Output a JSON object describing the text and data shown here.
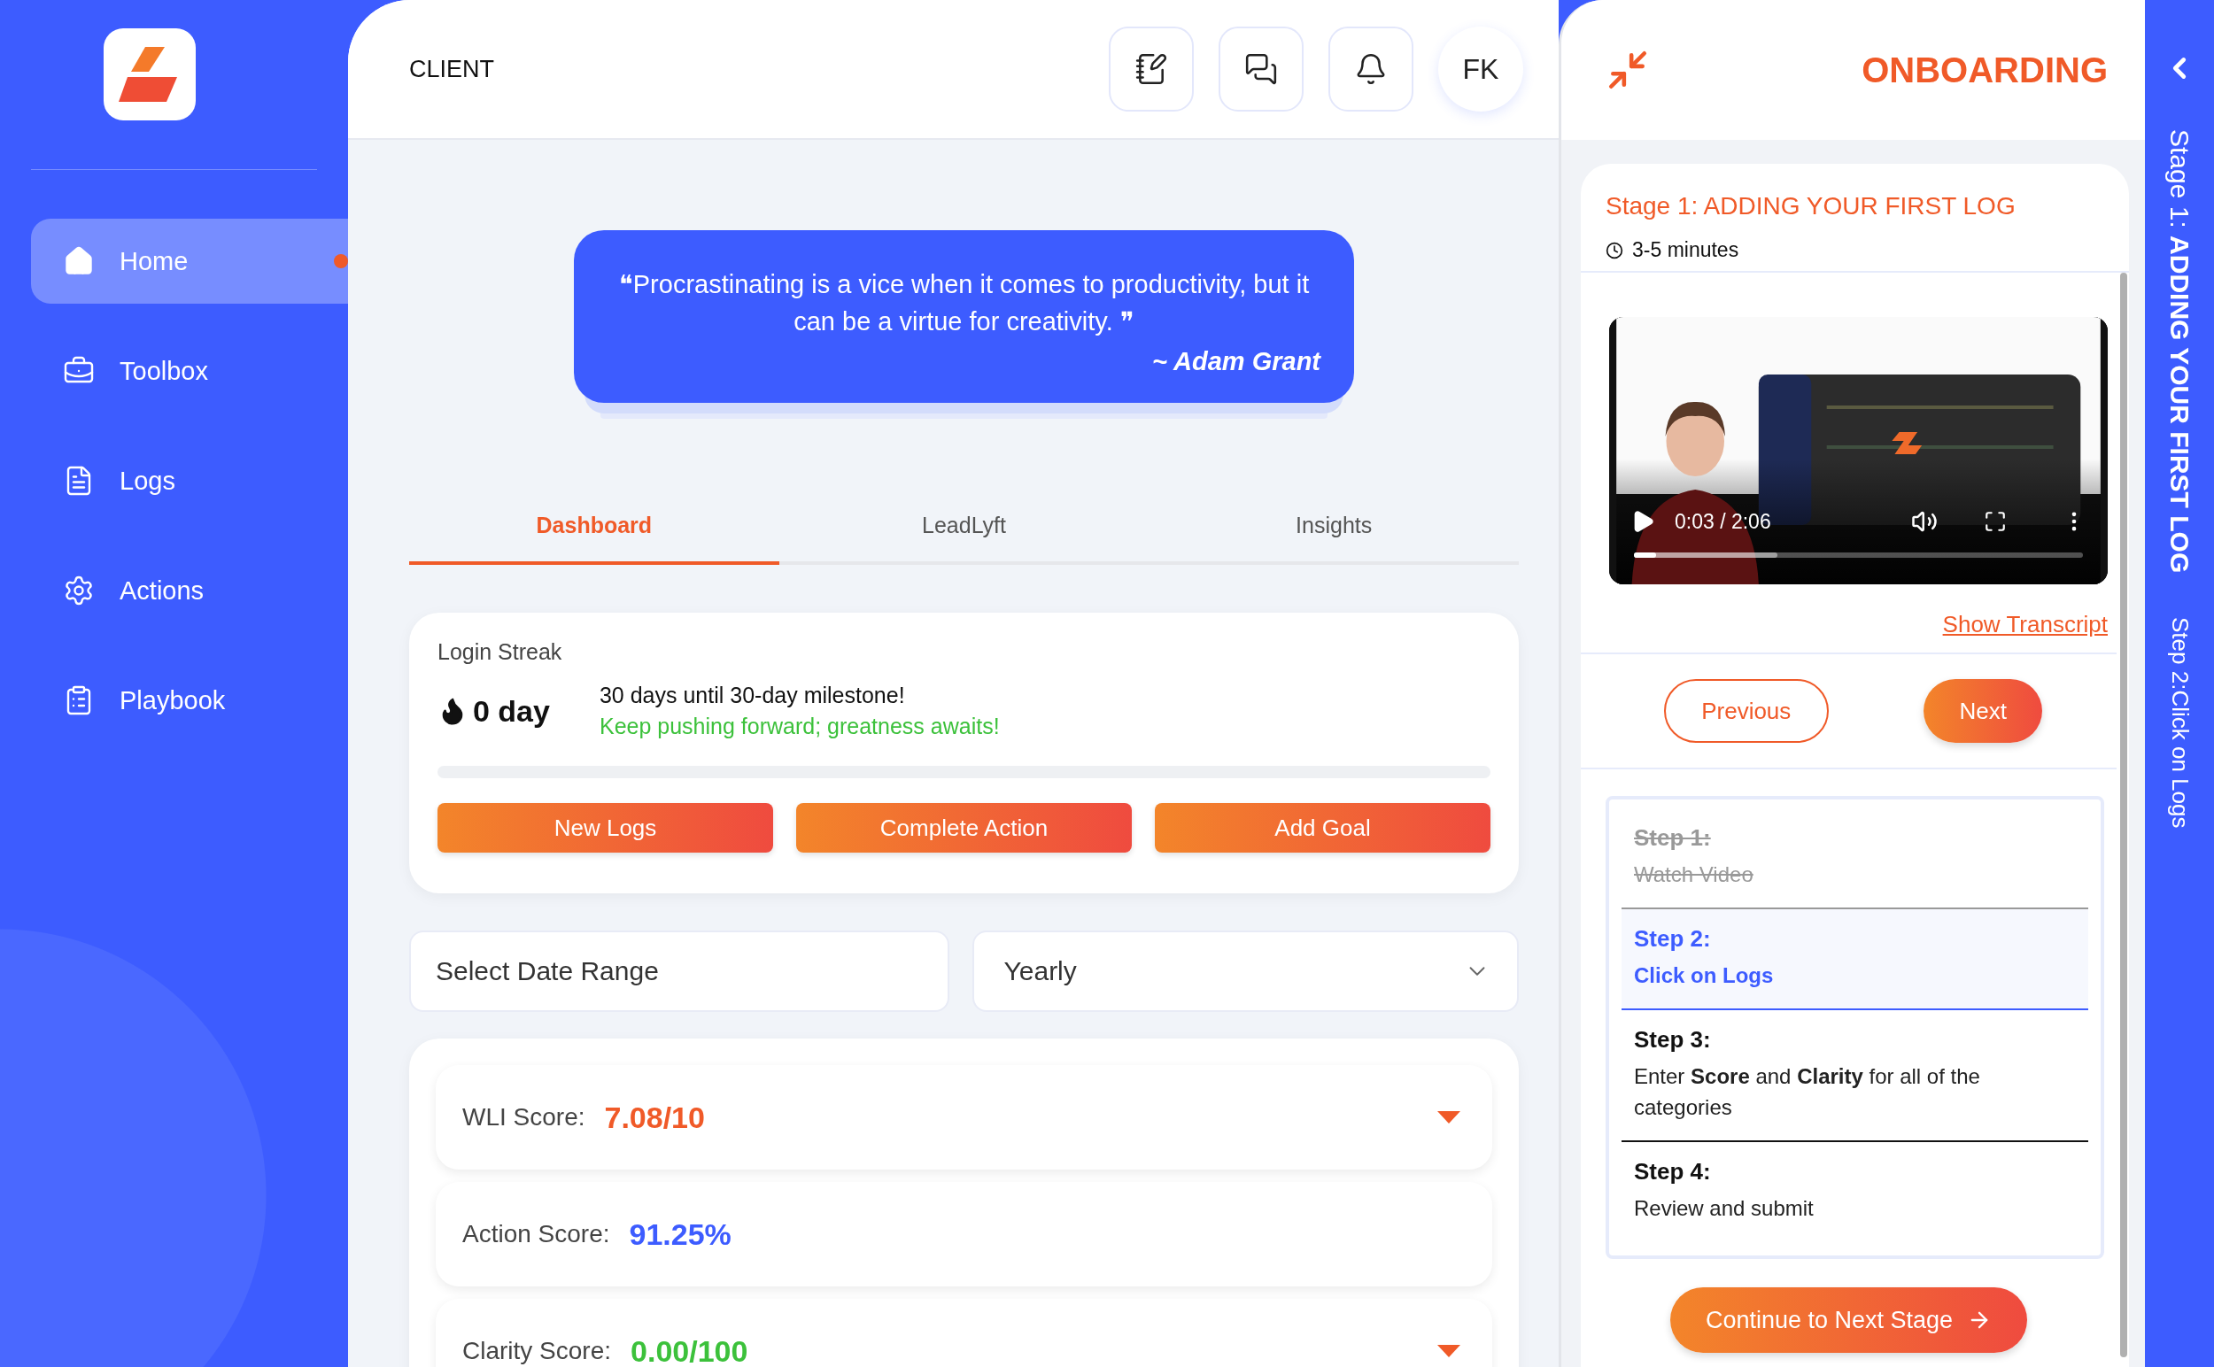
{
  "sidebar": {
    "items": [
      {
        "label": "Home",
        "selected": true
      },
      {
        "label": "Toolbox",
        "selected": false
      },
      {
        "label": "Logs",
        "selected": false
      },
      {
        "label": "Actions",
        "selected": false
      },
      {
        "label": "Playbook",
        "selected": false
      }
    ]
  },
  "header": {
    "title": "CLIENT",
    "avatar": "FK"
  },
  "quote": {
    "text": "❝Procrastinating is a vice when it comes to productivity, but it can be a virtue for creativity. ❞",
    "author": "~ Adam Grant"
  },
  "tabs": [
    {
      "label": "Dashboard",
      "selected": true
    },
    {
      "label": "LeadLyft",
      "selected": false
    },
    {
      "label": "Insights",
      "selected": false
    }
  ],
  "login_streak": {
    "title": "Login Streak",
    "streak": "0 day",
    "message": "30 days until 30-day milestone!",
    "encouragement": "Keep pushing forward; greatness awaits!",
    "level": 0,
    "buttons": [
      "New Logs",
      "Complete Action",
      "Add Goal"
    ]
  },
  "filters": {
    "date_range": {
      "placeholder": "Select Date Range"
    },
    "period": {
      "value": "Yearly"
    }
  },
  "scores": [
    {
      "label": "WLI Score:",
      "value": "7.08/10",
      "color": "#f05a28",
      "expandable": true
    },
    {
      "label": "Action Score:",
      "value": "91.25%",
      "color": "#3d5cff",
      "expandable": false
    },
    {
      "label": "Clarity Score:",
      "value": "0.00/100",
      "color": "#3cc13b",
      "expandable": true
    }
  ],
  "onboarding": {
    "title": "ONBOARDING",
    "stage_title": "Stage 1: ADDING YOUR FIRST LOG",
    "duration": "3-5 minutes",
    "video": {
      "time": "0:03 / 2:06",
      "level": 0.05
    },
    "transcript_link": "Show Transcript",
    "previous": "Previous",
    "next": "Next",
    "steps": [
      {
        "title": "Step 1:",
        "text": "Watch Video",
        "done": true,
        "selected": false
      },
      {
        "title": "Step 2:",
        "text": "Click on Logs",
        "done": false,
        "selected": true
      },
      {
        "title": "Step 3:",
        "text": "Enter **Score** and **Clarity** for all of the categories",
        "done": false,
        "selected": false
      },
      {
        "title": "Step 4:",
        "text": "Review and submit",
        "done": false,
        "selected": false
      }
    ],
    "continue": "Continue to Next Stage"
  },
  "progress_strip": {
    "stage": "Stage 1: **ADDING YOUR FIRST LOG**",
    "step": "Step 2:Click on Logs"
  }
}
